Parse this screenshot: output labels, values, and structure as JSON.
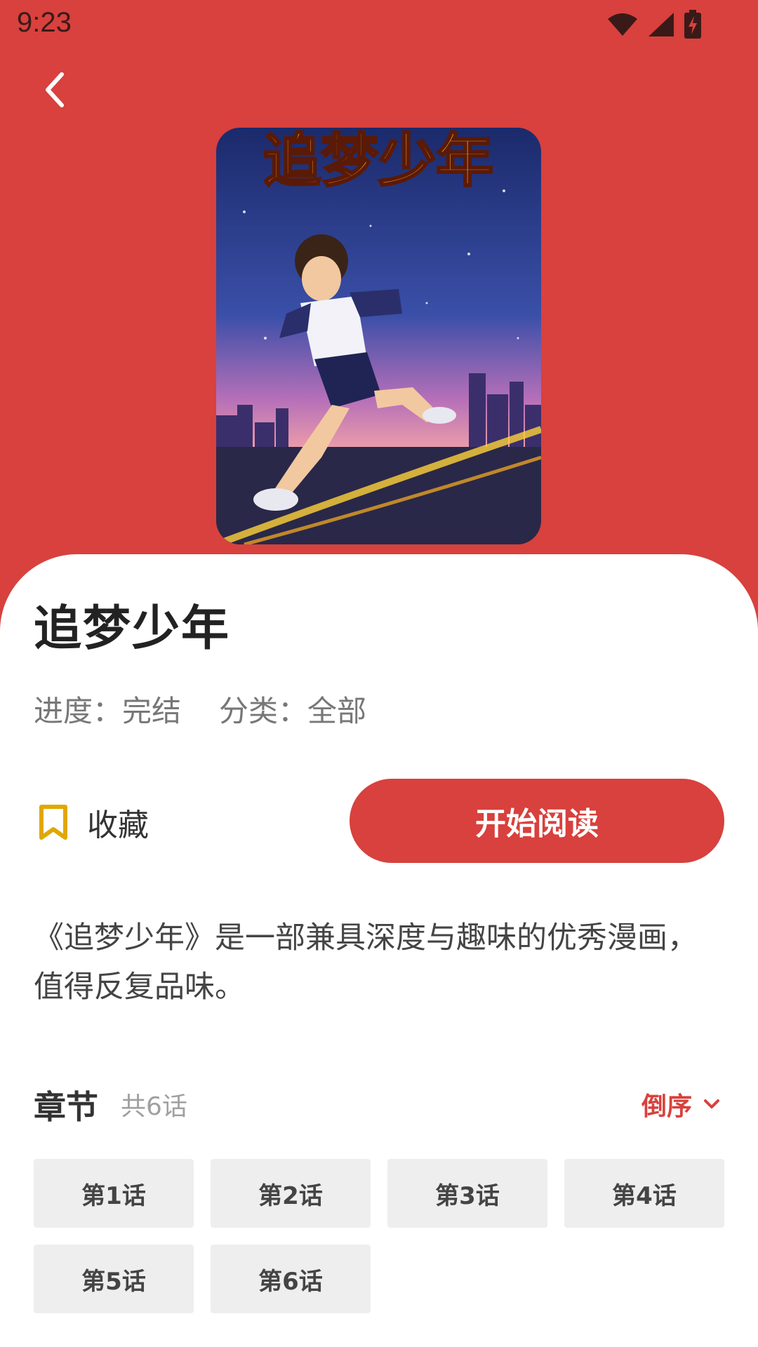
{
  "status_bar": {
    "time": "9:23",
    "icons": [
      "wifi-icon",
      "signal-icon",
      "battery-charging-icon"
    ]
  },
  "header": {
    "back_icon": "chevron-left-icon"
  },
  "cover": {
    "title_art": "追梦少年"
  },
  "comic": {
    "title": "追梦少年",
    "progress_label": "进度：",
    "progress_value": "完结",
    "category_label": "分类：",
    "category_value": "全部"
  },
  "actions": {
    "collect_icon": "bookmark-icon",
    "collect_label": "收藏",
    "read_label": "开始阅读"
  },
  "description": "《追梦少年》是一部兼具深度与趣味的优秀漫画，值得反复品味。",
  "chapters": {
    "title": "章节",
    "count": "共6话",
    "sort_label": "倒序",
    "sort_icon": "chevron-down-icon",
    "items": [
      {
        "label": "第1话"
      },
      {
        "label": "第2话"
      },
      {
        "label": "第3话"
      },
      {
        "label": "第4话"
      },
      {
        "label": "第5话"
      },
      {
        "label": "第6话"
      }
    ]
  },
  "colors": {
    "accent": "#d8413d",
    "bookmark": "#e0a800",
    "chapter_bg": "#eeeeee"
  }
}
